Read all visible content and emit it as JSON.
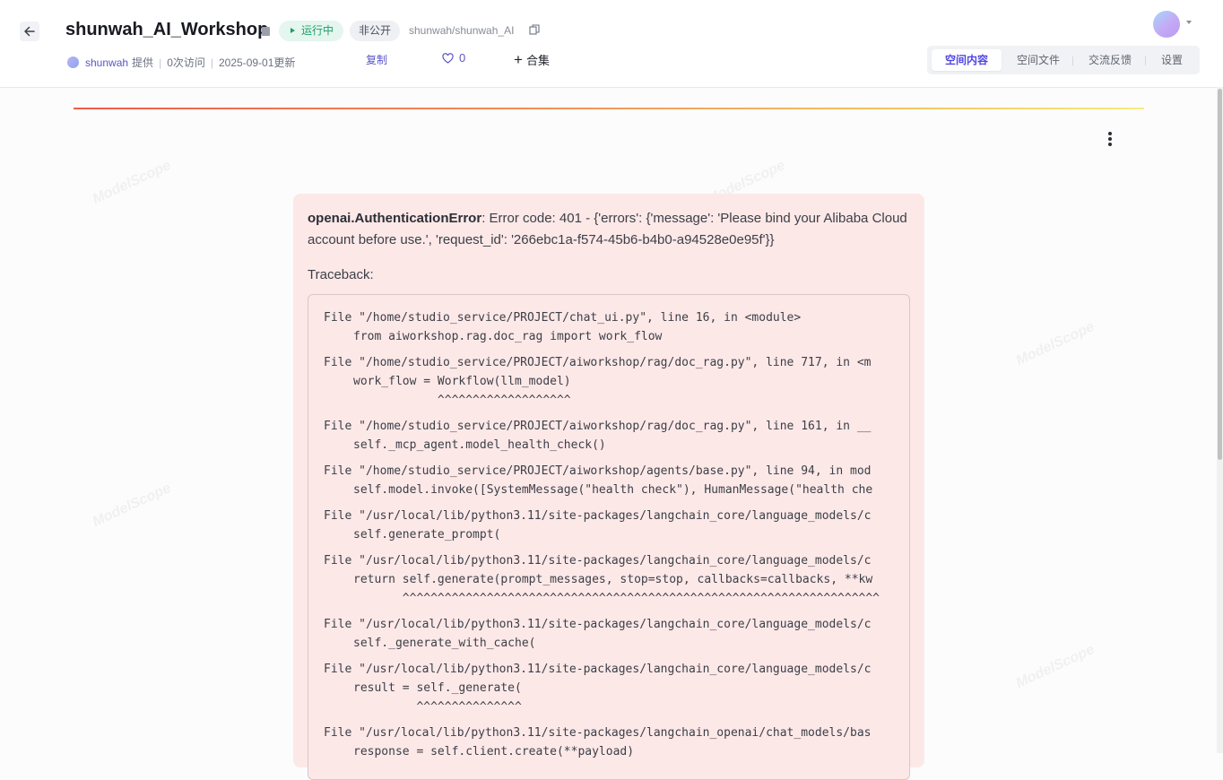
{
  "header": {
    "title": "shunwah_AI_Workshop",
    "status_label": "运行中",
    "visibility_label": "非公开",
    "repo_path": "shunwah/shunwah_AI",
    "author": "shunwah",
    "provided_label": "提供",
    "visits": "0次访问",
    "updated": "2025-09-01更新",
    "copy_label": "复制",
    "like_count": "0",
    "collect_label": "合集"
  },
  "tabs": [
    {
      "label": "空间内容",
      "active": true
    },
    {
      "label": "空间文件",
      "active": false
    },
    {
      "label": "交流反馈",
      "active": false
    },
    {
      "label": "设置",
      "active": false
    }
  ],
  "watermark": "ModelScope",
  "error": {
    "type": "openai.AuthenticationError",
    "message": ": Error code: 401 - {'errors': {'message': 'Please bind your Alibaba Cloud account before use.', 'request_id': '266ebc1a-f574-45b6-b4b0-a94528e0e95f'}}",
    "traceback_label": "Traceback:",
    "frames": [
      {
        "file": "File \"/home/studio_service/PROJECT/chat_ui.py\", line 16, in <module>",
        "code": [
          "from aiworkshop.rag.doc_rag import work_flow"
        ]
      },
      {
        "file": "File \"/home/studio_service/PROJECT/aiworkshop/rag/doc_rag.py\", line 717, in <m",
        "code": [
          "work_flow = Workflow(llm_model)",
          "            ^^^^^^^^^^^^^^^^^^^"
        ]
      },
      {
        "file": "File \"/home/studio_service/PROJECT/aiworkshop/rag/doc_rag.py\", line 161, in __",
        "code": [
          "self._mcp_agent.model_health_check()"
        ]
      },
      {
        "file": "File \"/home/studio_service/PROJECT/aiworkshop/agents/base.py\", line 94, in mod",
        "code": [
          "self.model.invoke([SystemMessage(\"health check\"), HumanMessage(\"health che"
        ]
      },
      {
        "file": "File \"/usr/local/lib/python3.11/site-packages/langchain_core/language_models/c",
        "code": [
          "self.generate_prompt("
        ]
      },
      {
        "file": "File \"/usr/local/lib/python3.11/site-packages/langchain_core/language_models/c",
        "code": [
          "return self.generate(prompt_messages, stop=stop, callbacks=callbacks, **kw",
          "       ^^^^^^^^^^^^^^^^^^^^^^^^^^^^^^^^^^^^^^^^^^^^^^^^^^^^^^^^^^^^^^^^^^^^"
        ]
      },
      {
        "file": "File \"/usr/local/lib/python3.11/site-packages/langchain_core/language_models/c",
        "code": [
          "self._generate_with_cache("
        ]
      },
      {
        "file": "File \"/usr/local/lib/python3.11/site-packages/langchain_core/language_models/c",
        "code": [
          "result = self._generate(",
          "         ^^^^^^^^^^^^^^^"
        ]
      },
      {
        "file": "File \"/usr/local/lib/python3.11/site-packages/langchain_openai/chat_models/bas",
        "code": [
          "response = self.client.create(**payload)"
        ]
      }
    ]
  }
}
